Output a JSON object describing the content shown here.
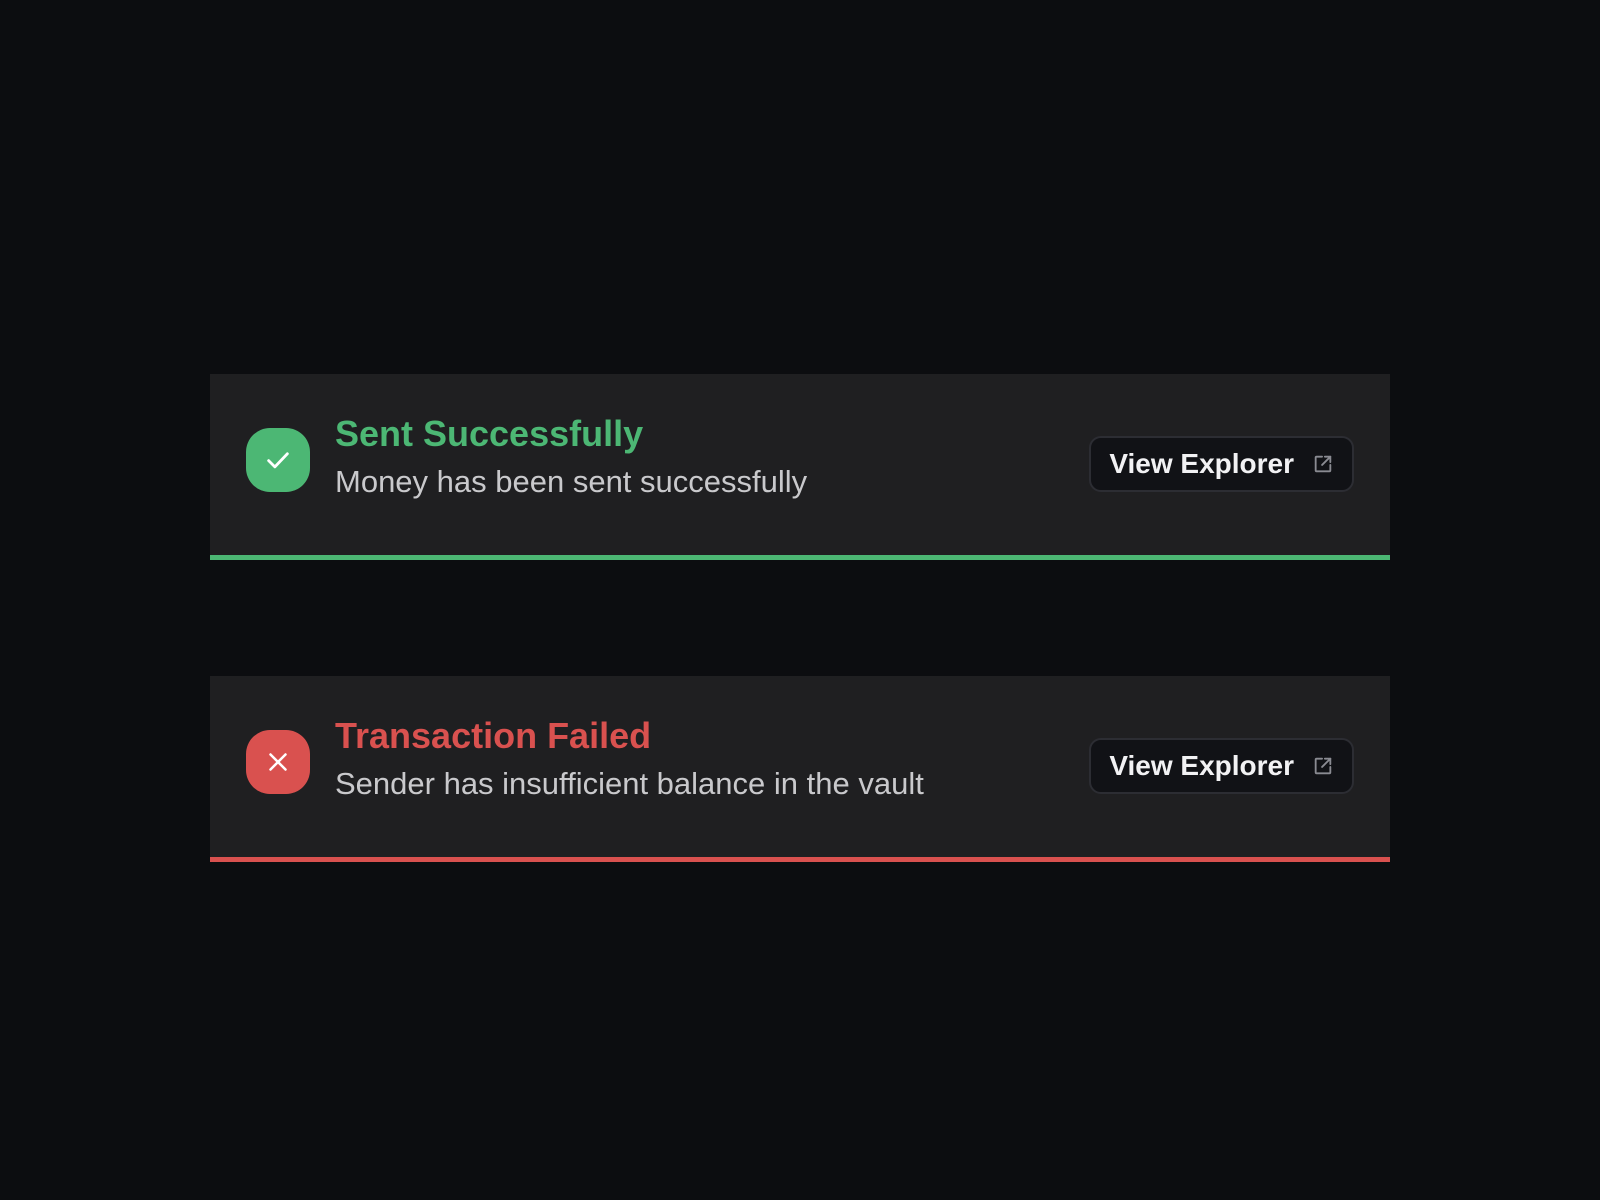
{
  "colors": {
    "background": "#0c0d10",
    "card": "#1f1f21",
    "success": "#4cb774",
    "error": "#d9514f",
    "button_bg": "#111216",
    "button_border": "#2c2d33"
  },
  "toasts": [
    {
      "status": "success",
      "icon": "check-icon",
      "title": "Sent Successfully",
      "message": "Money has been sent successfully",
      "button_label": "View Explorer",
      "button_icon": "external-link-icon"
    },
    {
      "status": "error",
      "icon": "close-icon",
      "title": "Transaction Failed",
      "message": "Sender has insufficient balance in the vault",
      "button_label": "View Explorer",
      "button_icon": "external-link-icon"
    }
  ]
}
